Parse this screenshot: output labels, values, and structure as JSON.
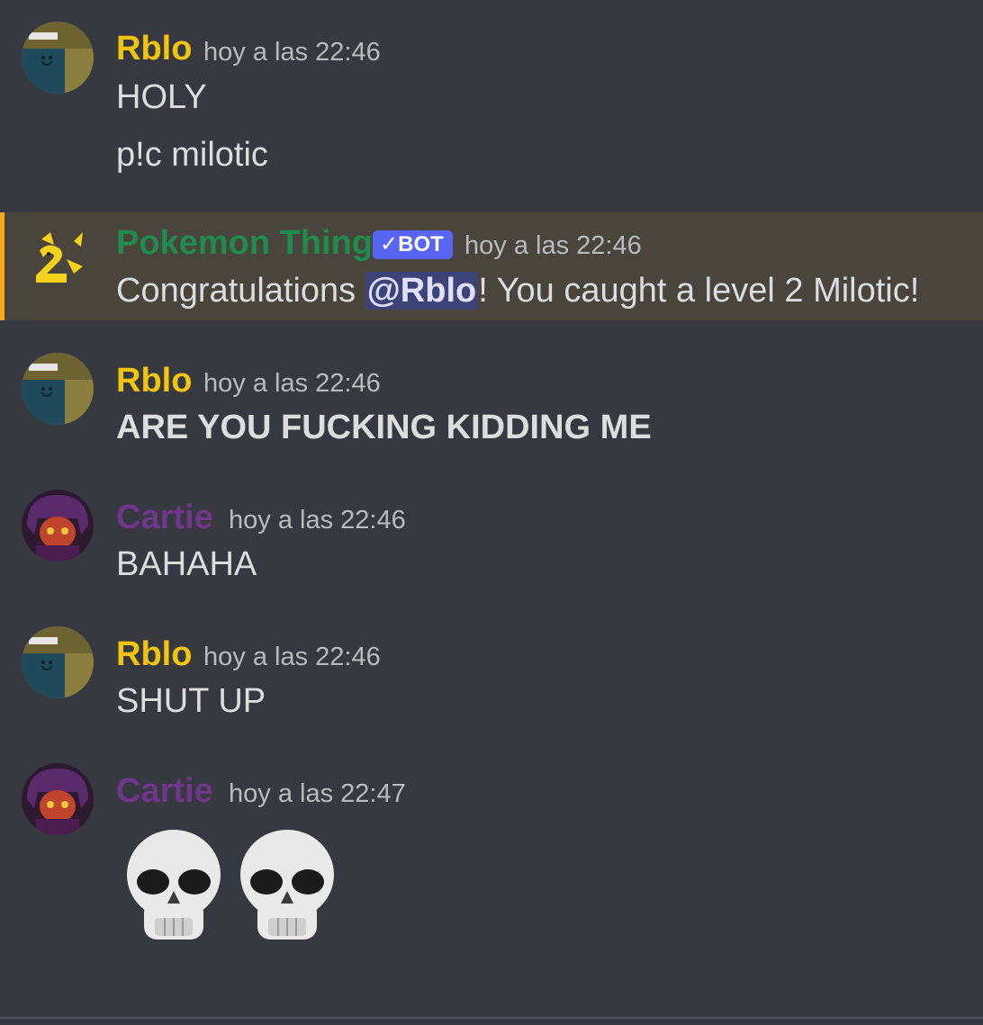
{
  "messages": [
    {
      "author": "Rblo",
      "timestamp": "hoy a las 22:46",
      "lines": [
        "HOLY",
        "p!c milotic"
      ]
    },
    {
      "author": "Pokemon Thing",
      "badge": "BOT",
      "timestamp": "hoy a las 22:46",
      "text_before": "Congratulations ",
      "mention": "@Rblo",
      "text_after": "! You caught a level 2 Milotic!"
    },
    {
      "author": "Rblo",
      "timestamp": "hoy a las 22:46",
      "text": "ARE YOU FUCKING KIDDING ME"
    },
    {
      "author": "Cartie",
      "timestamp": "hoy a las 22:46",
      "text": "BAHAHA"
    },
    {
      "author": "Rblo",
      "timestamp": "hoy a las 22:46",
      "text": "SHUT UP"
    },
    {
      "author": "Cartie",
      "timestamp": "hoy a las 22:47",
      "emoji": [
        "skull-emoji",
        "skull-emoji"
      ]
    }
  ],
  "colors": {
    "background": "#36393f",
    "rblo": "#f1c40f",
    "cartie": "#71368a",
    "pokemon_thing": "#1f8b4c",
    "bot_badge": "#5865f2",
    "mention_highlight": "#faa61a"
  }
}
